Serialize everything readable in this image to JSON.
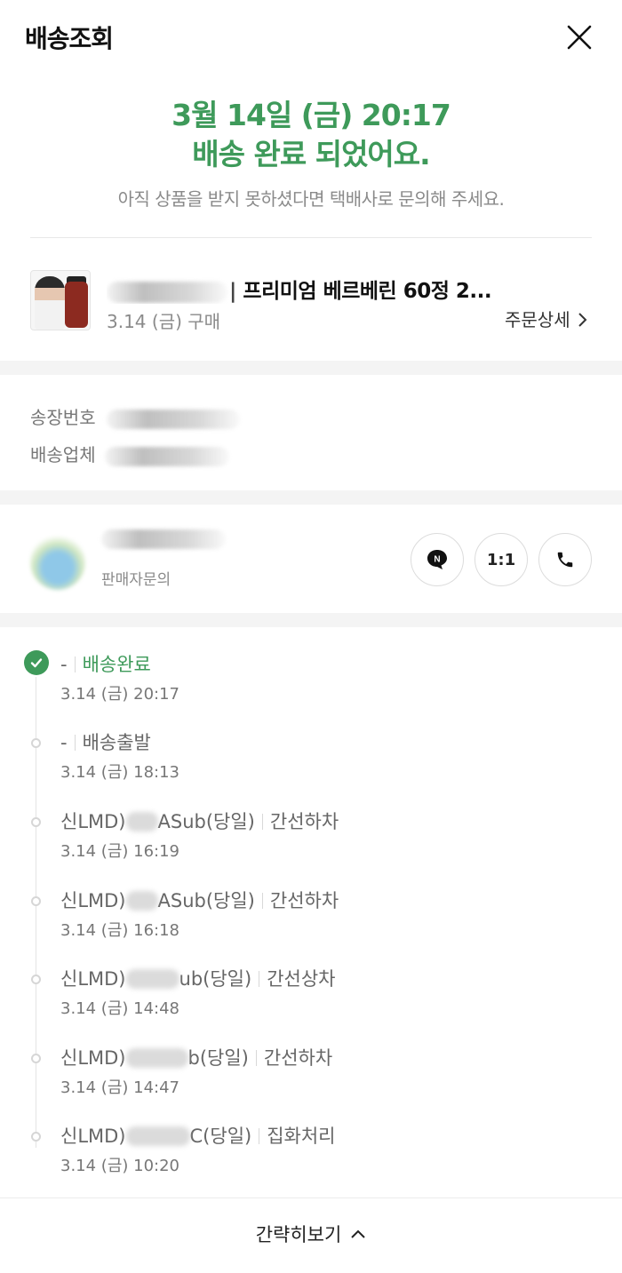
{
  "header": {
    "title": "배송조회"
  },
  "status": {
    "datetime": "3월 14일 (금) 20:17",
    "message": "배송 완료 되었어요.",
    "hint": "아직 상품을 받지 못하셨다면 택배사로 문의해 주세요."
  },
  "product": {
    "title": "프리미엄 베르베린 60정 2...",
    "purchase_date": "3.14 (금) 구매",
    "order_detail_label": "주문상세"
  },
  "invoice": {
    "tracking_label": "송장번호",
    "carrier_label": "배송업체"
  },
  "seller": {
    "inquiry_label": "판매자문의",
    "one_to_one_label": "1:1"
  },
  "timeline": [
    {
      "location": "-",
      "status": "배송완료",
      "time": "3.14 (금) 20:17"
    },
    {
      "location": "-",
      "status": "배송출발",
      "time": "3.14 (금) 18:13"
    },
    {
      "location_prefix": "신LMD)",
      "location_suffix": "ASub(당일)",
      "status": "간선하차",
      "time": "3.14 (금) 16:19"
    },
    {
      "location_prefix": "신LMD)",
      "location_suffix": "ASub(당일)",
      "status": "간선하차",
      "time": "3.14 (금) 16:18"
    },
    {
      "location_prefix": "신LMD)",
      "location_suffix": "ub(당일)",
      "status": "간선상차",
      "time": "3.14 (금) 14:48"
    },
    {
      "location_prefix": "신LMD)",
      "location_suffix": "b(당일)",
      "status": "간선하차",
      "time": "3.14 (금) 14:47"
    },
    {
      "location_prefix": "신LMD)",
      "location_suffix": "C(당일)",
      "status": "집화처리",
      "time": "3.14 (금) 10:20"
    }
  ],
  "footer": {
    "collapse_label": "간략히보기"
  },
  "colors": {
    "accent_green": "#3e9a5a",
    "gray_text": "#8a8a8a",
    "section_gap": "#f4f4f4"
  }
}
